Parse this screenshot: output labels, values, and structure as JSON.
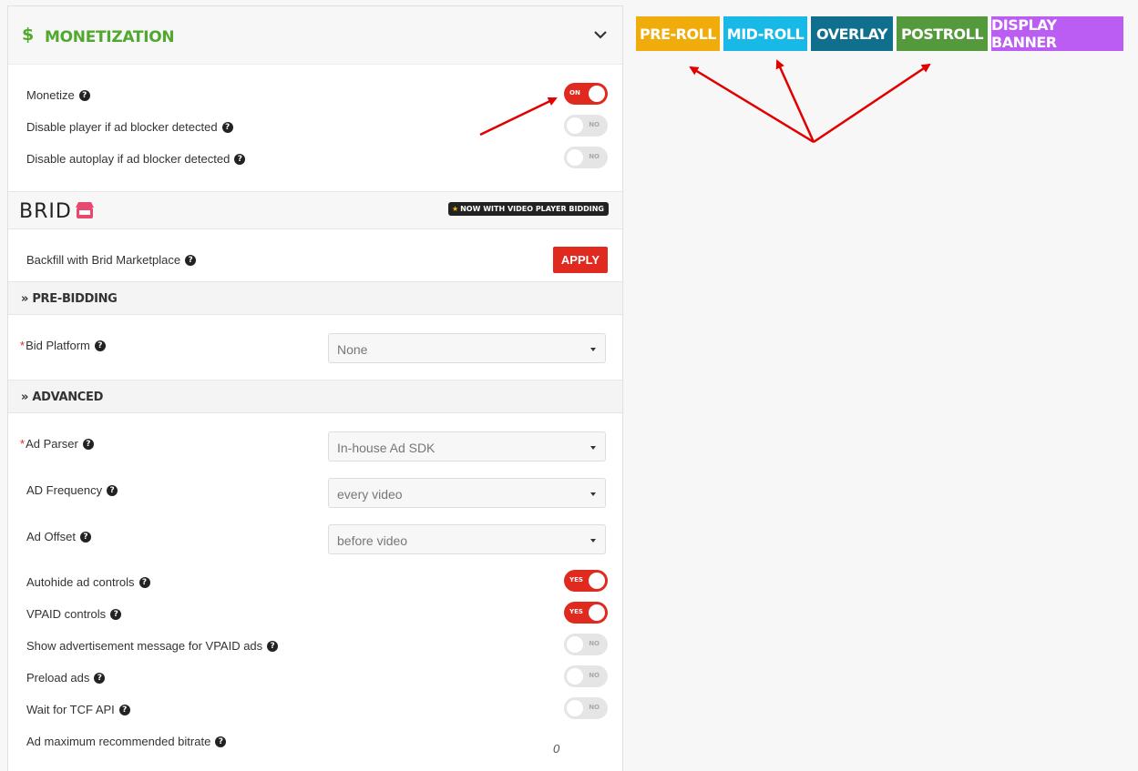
{
  "panel": {
    "title": "MONETIZATION",
    "dollar": "$",
    "monetize": {
      "label": "Monetize",
      "toggle": "ON"
    },
    "disable_player": {
      "label": "Disable player if ad blocker detected",
      "toggle": "NO"
    },
    "disable_autoplay": {
      "label": "Disable autoplay if ad blocker detected",
      "toggle": "NO"
    }
  },
  "brid": {
    "logo": "BRID",
    "badge": "NOW WITH VIDEO PLAYER BIDDING",
    "backfill_label": "Backfill with Brid Marketplace",
    "apply_label": "APPLY"
  },
  "prebidding": {
    "title": "PRE-BIDDING",
    "bid_platform": {
      "label": "Bid Platform",
      "value": "None"
    }
  },
  "advanced": {
    "title": "ADVANCED",
    "ad_parser": {
      "label": "Ad Parser",
      "value": "In-house Ad SDK"
    },
    "ad_frequency": {
      "label": "AD Frequency",
      "value": "every video"
    },
    "ad_offset": {
      "label": "Ad Offset",
      "value": "before video"
    },
    "autohide": {
      "label": "Autohide ad controls",
      "toggle": "YES"
    },
    "vpaid_controls": {
      "label": "VPAID controls",
      "toggle": "YES"
    },
    "show_ad_message": {
      "label": "Show advertisement message for VPAID ads",
      "toggle": "NO"
    },
    "preload": {
      "label": "Preload ads",
      "toggle": "NO"
    },
    "tcf": {
      "label": "Wait for TCF API",
      "toggle": "NO"
    },
    "bitrate": {
      "label": "Ad maximum recommended bitrate",
      "value": "0"
    }
  },
  "tabs": [
    {
      "label": "PRE-ROLL",
      "color": "#f0ac0b"
    },
    {
      "label": "MID-ROLL",
      "color": "#18b9e6"
    },
    {
      "label": "OVERLAY",
      "color": "#0f6f8c"
    },
    {
      "label": "POSTROLL",
      "color": "#549a3c"
    },
    {
      "label": "DISPLAY BANNER",
      "color": "#bb5cf2"
    }
  ],
  "colors": {
    "accent_green": "#51a82e",
    "toggle_on": "#e02a1f",
    "arrow": "#e00000"
  },
  "icons": [
    "dollar-icon",
    "chevron-down-icon",
    "help-icon",
    "store-icon",
    "star-icon",
    "double-chevron-right-icon",
    "caret-down-icon"
  ]
}
